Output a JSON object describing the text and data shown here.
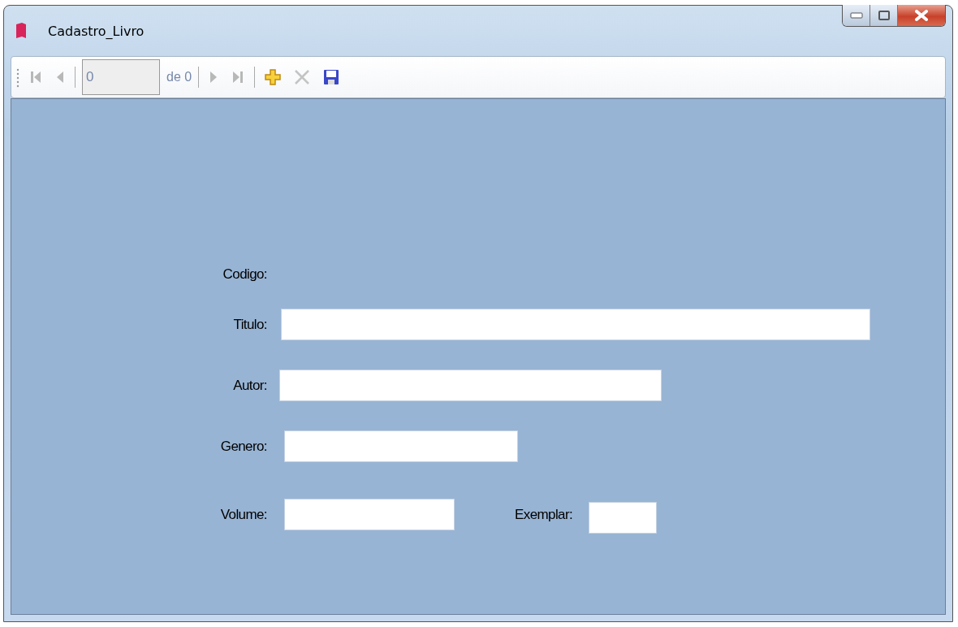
{
  "window": {
    "title": "Cadastro_Livro"
  },
  "toolbar": {
    "items": [
      {
        "kind": "first",
        "disabled": true
      },
      {
        "kind": "prev",
        "disabled": true
      },
      {
        "kind": "sep"
      },
      {
        "kind": "position",
        "value": "0"
      },
      {
        "kind": "count",
        "text": "de 0"
      },
      {
        "kind": "sep"
      },
      {
        "kind": "next",
        "disabled": true
      },
      {
        "kind": "last",
        "disabled": true
      },
      {
        "kind": "sep"
      },
      {
        "kind": "add",
        "disabled": false
      },
      {
        "kind": "delete",
        "disabled": true
      },
      {
        "kind": "save",
        "disabled": false
      }
    ]
  },
  "form": {
    "rows": [
      {
        "fields": [
          {
            "label": "Codigo:",
            "kind": "label"
          }
        ]
      },
      {
        "fields": [
          {
            "label": "Titulo:",
            "kind": "input"
          }
        ]
      },
      {
        "fields": [
          {
            "label": "Autor:",
            "kind": "input"
          }
        ]
      },
      {
        "fields": [
          {
            "label": "Genero:",
            "kind": "input"
          }
        ]
      },
      {
        "fields": [
          {
            "label": "Volume:",
            "kind": "input"
          },
          {
            "label": "Exemplar:",
            "kind": "input"
          }
        ]
      }
    ]
  }
}
